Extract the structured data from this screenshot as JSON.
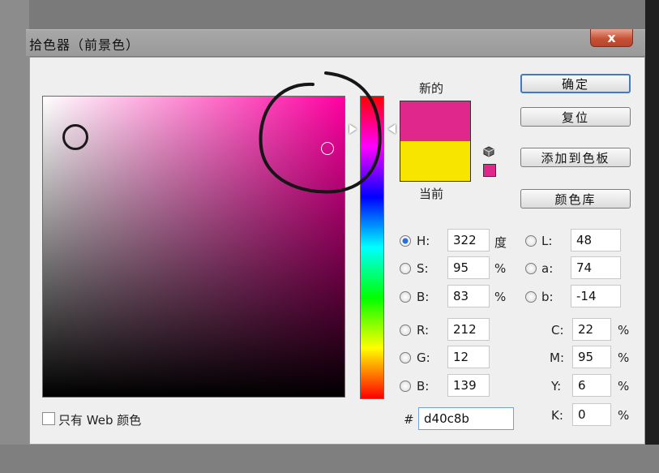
{
  "window": {
    "title": "拾色器（前景色）",
    "close_label": "x"
  },
  "picker": {
    "hue_degrees": 322
  },
  "preview": {
    "new_label": "新的",
    "current_label": "当前",
    "new_color": "#e0288c",
    "current_color": "#f7e500",
    "websafe_color": "#e0288c"
  },
  "buttons": {
    "ok": "确定",
    "reset": "复位",
    "add_to_swatches": "添加到色板",
    "color_libraries": "颜色库"
  },
  "hsb": [
    {
      "label": "H:",
      "value": "322",
      "unit": "度",
      "selected": true
    },
    {
      "label": "S:",
      "value": "95",
      "unit": "%",
      "selected": false
    },
    {
      "label": "B:",
      "value": "83",
      "unit": "%",
      "selected": false
    }
  ],
  "rgb": [
    {
      "label": "R:",
      "value": "212"
    },
    {
      "label": "G:",
      "value": "12"
    },
    {
      "label": "B:",
      "value": "139"
    }
  ],
  "lab": [
    {
      "label": "L:",
      "value": "48"
    },
    {
      "label": "a:",
      "value": "74"
    },
    {
      "label": "b:",
      "value": "-14"
    }
  ],
  "cmyk": [
    {
      "label": "C:",
      "value": "22",
      "unit": "%"
    },
    {
      "label": "M:",
      "value": "95",
      "unit": "%"
    },
    {
      "label": "Y:",
      "value": "6",
      "unit": "%"
    },
    {
      "label": "K:",
      "value": "0",
      "unit": "%"
    }
  ],
  "hex": {
    "prefix": "#",
    "value": "d40c8b"
  },
  "web_only": {
    "label": "只有 Web 颜色",
    "checked": false
  }
}
